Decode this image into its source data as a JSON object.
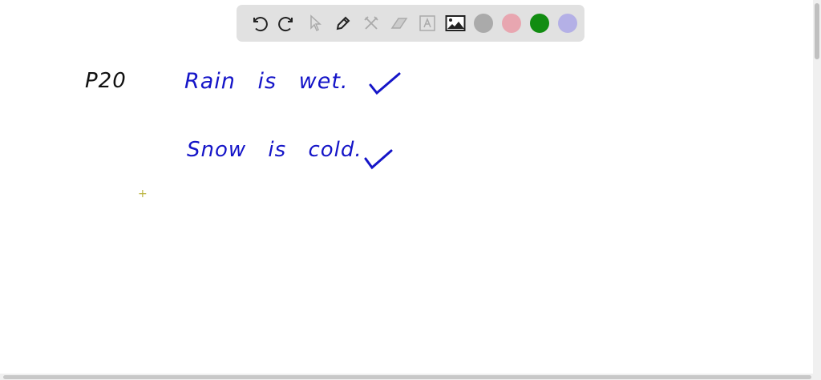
{
  "toolbar": {
    "tools": [
      "undo-icon",
      "redo-icon",
      "select-icon",
      "pen-icon",
      "tools-icon",
      "eraser-icon",
      "text-icon",
      "image-icon"
    ],
    "colors": [
      "#aaaaaa",
      "#e8a6b0",
      "#118c11",
      "#b4b0e6"
    ]
  },
  "canvas": {
    "label": "P20",
    "line1": "Rain is wet.",
    "line2": "Snow is cold.",
    "ink_color": "#1515c8"
  }
}
